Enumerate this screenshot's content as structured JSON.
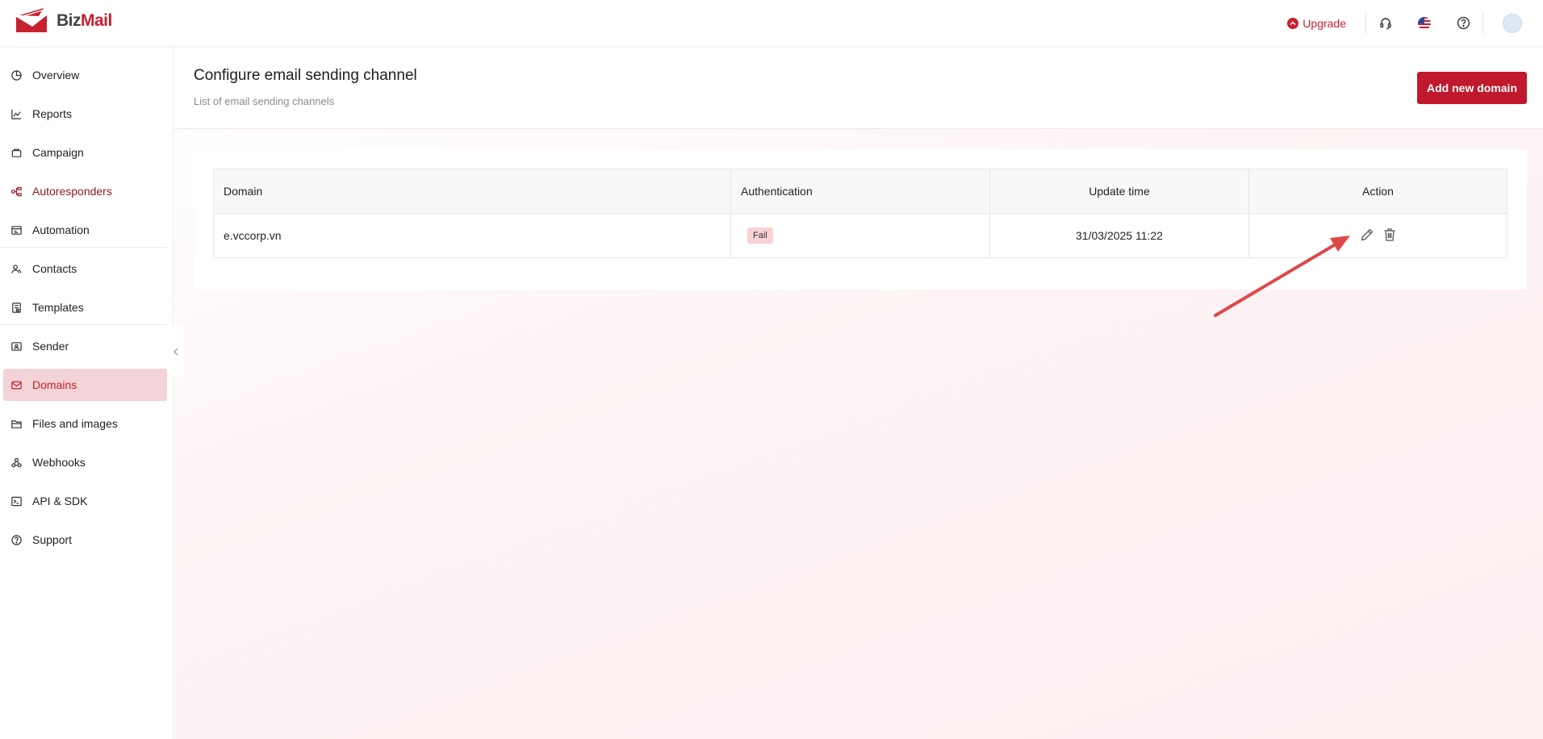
{
  "brand": {
    "part1": "Biz",
    "part2": "Mail",
    "accent": "#c8202f"
  },
  "header": {
    "upgrade_label": "Upgrade",
    "icons": [
      "headset-icon",
      "us-flag-icon",
      "help-icon",
      "avatar"
    ]
  },
  "sidebar": {
    "items": [
      {
        "label": "Overview",
        "icon": "pie-chart-icon"
      },
      {
        "label": "Reports",
        "icon": "line-chart-icon"
      },
      {
        "label": "Campaign",
        "icon": "campaign-icon"
      },
      {
        "label": "Autoresponders",
        "icon": "flow-icon"
      },
      {
        "label": "Automation",
        "icon": "automation-icon"
      },
      {
        "label": "Contacts",
        "icon": "contacts-icon"
      },
      {
        "label": "Templates",
        "icon": "template-icon"
      },
      {
        "label": "Sender",
        "icon": "sender-icon"
      },
      {
        "label": "Domains",
        "icon": "mail-icon",
        "active": true
      },
      {
        "label": "Files and images",
        "icon": "folder-icon"
      },
      {
        "label": "Webhooks",
        "icon": "webhook-icon"
      },
      {
        "label": "API & SDK",
        "icon": "terminal-icon"
      },
      {
        "label": "Support",
        "icon": "help-icon"
      }
    ]
  },
  "page": {
    "title": "Configure email sending channel",
    "subtitle": "List of email sending channels",
    "add_button": "Add new domain"
  },
  "table": {
    "columns": [
      "Domain",
      "Authentication",
      "Update time",
      "Action"
    ],
    "rows": [
      {
        "domain": "e.vccorp.vn",
        "authentication": "Fail",
        "update_time": "31/03/2025 11:22",
        "actions": [
          "edit-icon",
          "trash-icon"
        ]
      }
    ]
  }
}
